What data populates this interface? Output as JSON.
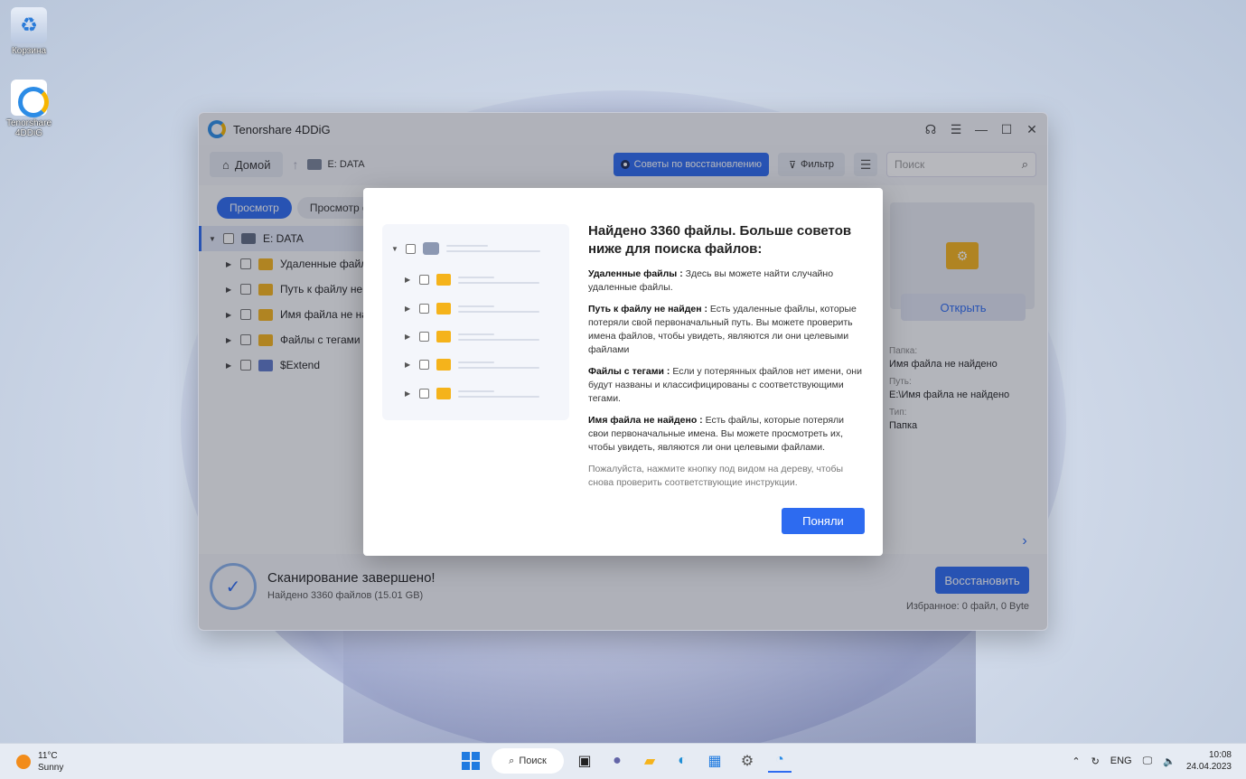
{
  "desktop": {
    "icons": [
      {
        "label": "Корзина"
      },
      {
        "label": "Tenorshare 4DDiG"
      }
    ]
  },
  "app": {
    "title": "Tenorshare 4DDiG",
    "toolbar": {
      "home_label": "Домой",
      "drive_path": "E: DATA",
      "tips_label": "Советы по восстановлению",
      "filter_label": "Фильтр",
      "search_placeholder": "Поиск"
    },
    "view_tabs": [
      "Просмотр",
      "Просмотр фа"
    ],
    "tree": {
      "root": "E: DATA",
      "children": [
        {
          "label": "Удаленные файлы",
          "color": "#f5b31b"
        },
        {
          "label": "Путь к файлу не на",
          "color": "#f5b31b"
        },
        {
          "label": "Имя файла не найд",
          "color": "#f5b31b"
        },
        {
          "label": "Файлы с тегами",
          "color": "#f5b31b"
        },
        {
          "label": "$Extend",
          "color": "#5d78c9"
        }
      ]
    },
    "details": {
      "open_label": "Открыть",
      "folder_label": "Папка:",
      "folder_value": "Имя файла не найдено",
      "path_label": "Путь:",
      "path_value": "E:\\Имя файла не найдено",
      "type_label": "Тип:",
      "type_value": "Папка"
    },
    "footer": {
      "scan_title": "Сканирование завершено!",
      "scan_sub": "Найдено 3360 файлов (15.01 GB)",
      "recover_label": "Восстановить",
      "selected_info": "Избранное: 0 файл, 0 Byte"
    }
  },
  "modal": {
    "title": "Найдено 3360 файлы. Больше советов ниже для поиска файлов:",
    "sections": [
      {
        "term": "Удаленные файлы :",
        "text": " Здесь вы можете найти случайно удаленные файлы."
      },
      {
        "term": "Путь к файлу не найден :",
        "text": " Есть удаленные файлы, которые потеряли свой первоначальный путь. Вы можете проверить имена файлов, чтобы увидеть, являются ли они целевыми файлами"
      },
      {
        "term": "Файлы с тегами :",
        "text": " Если у потерянных файлов нет имени, они будут названы и классифицированы с соответствующими тегами."
      },
      {
        "term": "Имя файла не найдено :",
        "text": " Есть файлы, которые потеряли свои первоначальные имена. Вы можете просмотреть их, чтобы увидеть, являются ли они целевыми файлами."
      }
    ],
    "note": "Пожалуйста, нажмите кнопку под видом на дереву, чтобы снова проверить соответствующие инструкции.",
    "ok_label": "Поняли"
  },
  "taskbar": {
    "weather_temp": "11°C",
    "weather_desc": "Sunny",
    "search_label": "Поиск",
    "lang": "ENG",
    "time": "10:08",
    "date": "24.04.2023"
  },
  "colors": {
    "accent": "#2d6bf0",
    "folder": "#f5b31b"
  }
}
